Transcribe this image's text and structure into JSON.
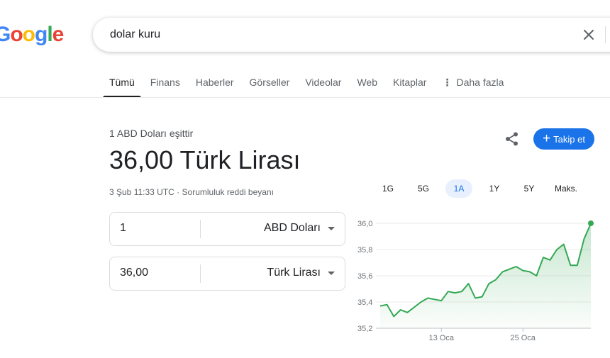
{
  "logo": {
    "letters": [
      "G",
      "o",
      "o",
      "g",
      "l",
      "e"
    ],
    "colors": [
      "#4285f4",
      "#ea4335",
      "#fbbc05",
      "#4285f4",
      "#34a853",
      "#ea4335"
    ]
  },
  "search": {
    "query": "dolar kuru",
    "clear_icon": "close-icon"
  },
  "tabs": [
    {
      "label": "Tümü",
      "active": true
    },
    {
      "label": "Finans"
    },
    {
      "label": "Haberler"
    },
    {
      "label": "Görseller"
    },
    {
      "label": "Videolar"
    },
    {
      "label": "Web"
    },
    {
      "label": "Kitaplar"
    },
    {
      "label": "Daha fazla",
      "icon": "more-vert-icon"
    }
  ],
  "result": {
    "equals_label": "1 ABD Doları eşittir",
    "value": "36,00 Türk Lirası",
    "timestamp": "3 Şub 11:33 UTC",
    "separator": "·",
    "disclaimer": "Sorumluluk reddi beyanı",
    "follow_label": "Takip et",
    "share_icon": "share-icon"
  },
  "ranges": [
    "1G",
    "5G",
    "1A",
    "1Y",
    "5Y",
    "Maks."
  ],
  "active_range": "1A",
  "converter": [
    {
      "amount": "1",
      "currency": "ABD Doları"
    },
    {
      "amount": "36,00",
      "currency": "Türk Lirası"
    }
  ],
  "colors": {
    "accent": "#1a73e8",
    "line": "#34a853"
  },
  "chart_data": {
    "type": "area",
    "y_ticks": [
      "36,0",
      "35,8",
      "35,6",
      "35,4",
      "35,2"
    ],
    "ylim": [
      35.2,
      36.0
    ],
    "x_ticks": [
      {
        "label": "13 Oca",
        "index": 9
      },
      {
        "label": "25 Oca",
        "index": 21
      }
    ],
    "values": [
      35.37,
      35.38,
      35.29,
      35.34,
      35.32,
      35.36,
      35.4,
      35.43,
      35.42,
      35.41,
      35.48,
      35.47,
      35.48,
      35.54,
      35.43,
      35.44,
      35.54,
      35.57,
      35.63,
      35.65,
      35.67,
      35.64,
      35.63,
      35.6,
      35.74,
      35.72,
      35.8,
      35.84,
      35.68,
      35.68,
      35.88,
      36.0
    ]
  }
}
